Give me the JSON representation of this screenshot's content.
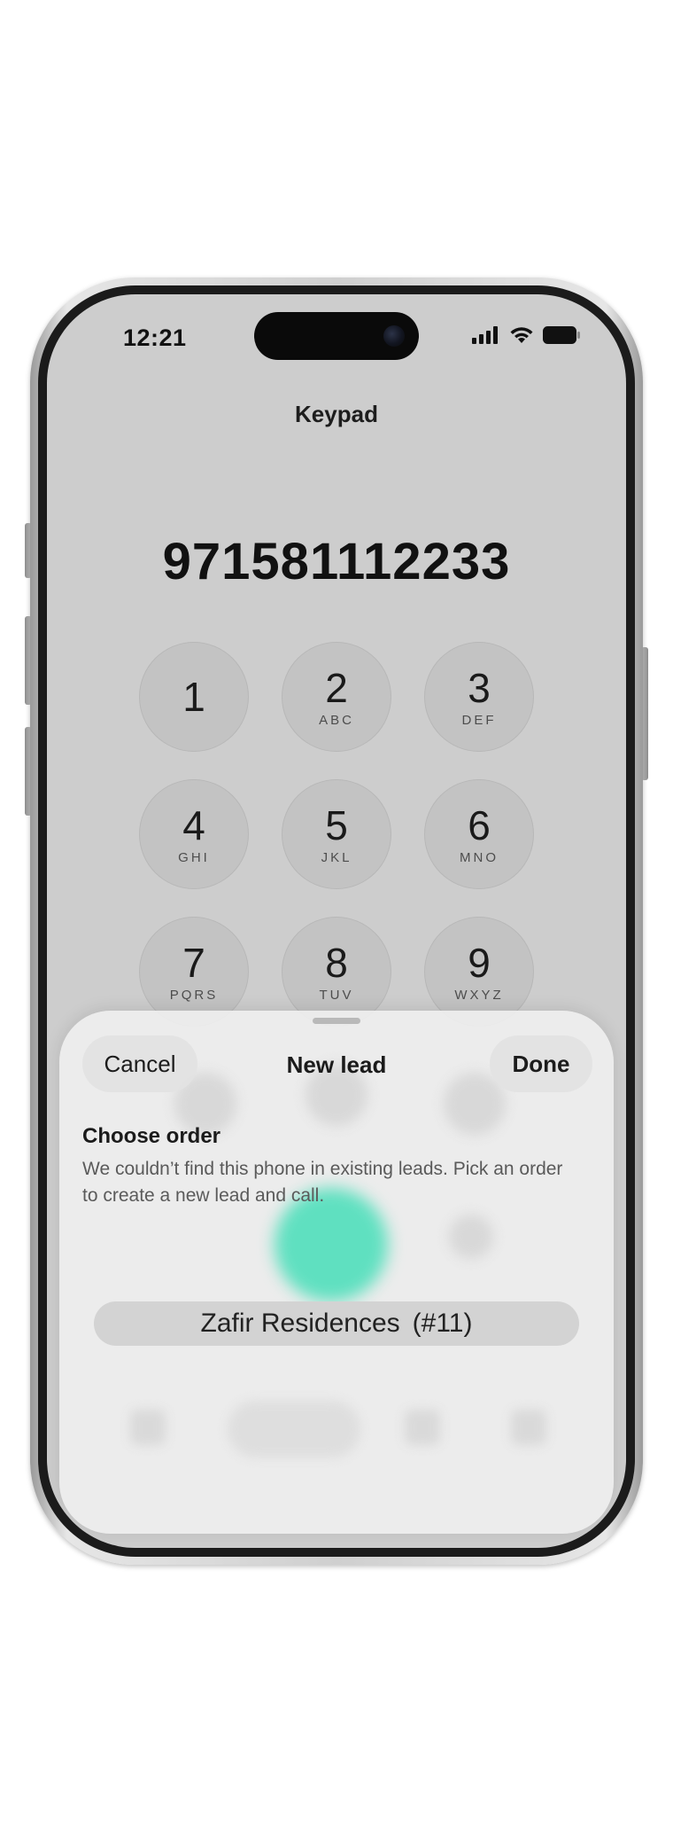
{
  "status_bar": {
    "time": "12:21",
    "icons": [
      "cellular-signal-icon",
      "wifi-icon",
      "battery-icon"
    ]
  },
  "keypad": {
    "title": "Keypad",
    "dialed_number": "971581112233",
    "keys": [
      {
        "digit": "1",
        "letters": ""
      },
      {
        "digit": "2",
        "letters": "ABC"
      },
      {
        "digit": "3",
        "letters": "DEF"
      },
      {
        "digit": "4",
        "letters": "GHI"
      },
      {
        "digit": "5",
        "letters": "JKL"
      },
      {
        "digit": "6",
        "letters": "MNO"
      },
      {
        "digit": "7",
        "letters": "PQRS"
      },
      {
        "digit": "8",
        "letters": "TUV"
      },
      {
        "digit": "9",
        "letters": "WXYZ"
      }
    ]
  },
  "sheet": {
    "cancel_label": "Cancel",
    "title": "New lead",
    "done_label": "Done",
    "section_title": "Choose order",
    "section_description": "We couldn’t find this phone in existing leads. Pick an order to create a new lead and call.",
    "selected_order": {
      "name": "Zafir Residences",
      "number": "(#11)"
    }
  },
  "colors": {
    "call_button": "#5fe0c0",
    "screen_background": "#cdcdcd",
    "sheet_background": "#eeeeee"
  }
}
